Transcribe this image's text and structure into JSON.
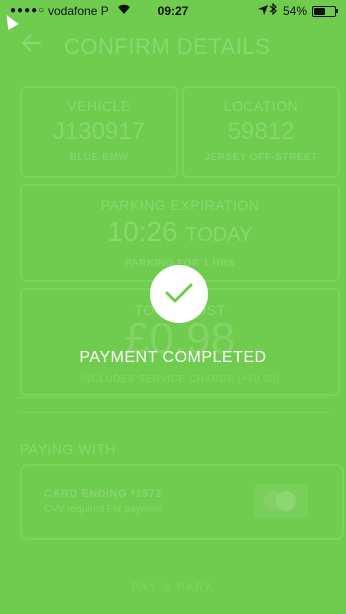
{
  "status_bar": {
    "signal_dots": "●●●●○",
    "carrier": "vodafone P",
    "time": "09:27",
    "battery": "54%",
    "battery_level": 0.54
  },
  "header": {
    "back_icon": "back-arrow-icon",
    "title": "CONFIRM DETAILS"
  },
  "vehicle": {
    "label": "VEHICLE",
    "value": "J130917",
    "description": "BLUE BMW"
  },
  "location": {
    "label": "LOCATION",
    "value": "59812",
    "description": "JERSEY OFF-STREET"
  },
  "expiration": {
    "label": "PARKING EXPIRATION",
    "time": "10:26",
    "day": "TODAY",
    "duration": "PARKING FOR 1 HRS"
  },
  "cost": {
    "label": "TOTAL COST",
    "value": "£0.98",
    "note": "INCLUDES SERVICE CHARGE (+£0.20)"
  },
  "payment": {
    "section_label": "PAYING WITH",
    "card_title": "CARD ENDING *1572",
    "card_note": "CVV required For payment",
    "card_icon": "mastercard-icon"
  },
  "action": {
    "label": "PAY & PARK"
  },
  "overlay": {
    "icon": "checkmark-icon",
    "message": "PAYMENT COMPLETED"
  },
  "colors": {
    "background": "#6fcc4f",
    "faded_text": "#8ad76e",
    "overlay_text": "#ffffff"
  }
}
